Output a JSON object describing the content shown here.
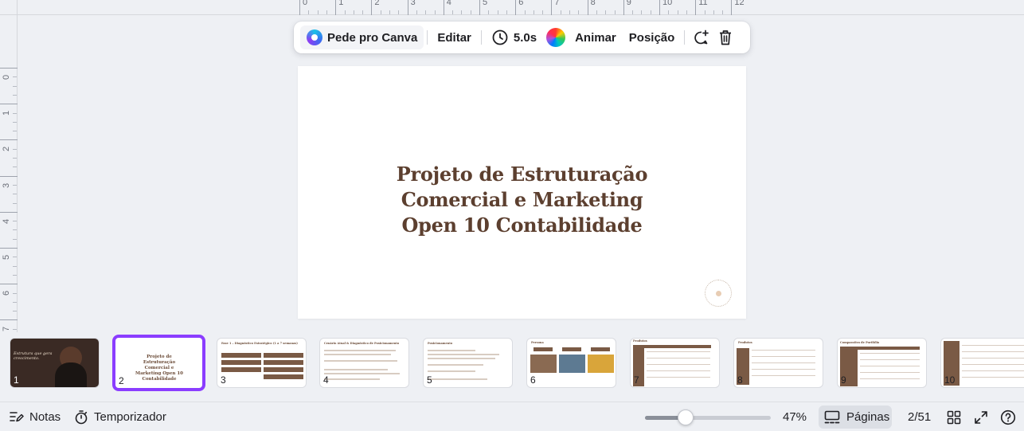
{
  "ruler": {
    "top_labels": [
      "0",
      "1",
      "2",
      "3",
      "4",
      "5",
      "6",
      "7",
      "8",
      "9",
      "10",
      "11",
      "12"
    ],
    "left_labels": [
      "0",
      "1",
      "2",
      "3",
      "4",
      "5",
      "6",
      "7"
    ]
  },
  "toolbar": {
    "ask_canva_label": "Pede pro Canva",
    "edit_label": "Editar",
    "duration_label": "5.0s",
    "animate_label": "Animar",
    "position_label": "Posição"
  },
  "slide": {
    "title_lines": [
      "Projeto de Estruturação",
      "Comercial e Marketing",
      "Open 10 Contabilidade"
    ]
  },
  "pages": [
    {
      "number": "1",
      "title": "Estrutura que gera crescimento."
    },
    {
      "number": "2",
      "title": "Projeto de Estruturação Comercial e Marketing Open 10 Contabilidade"
    },
    {
      "number": "3",
      "title": "Fase 1 – Diagnóstico Estratégico (1 a 7 semanas)"
    },
    {
      "number": "4",
      "title": "Cenário Atual & Diagnóstico de Posicionamento"
    },
    {
      "number": "5",
      "title": "Posicionamento"
    },
    {
      "number": "6",
      "title": "Persona"
    },
    {
      "number": "7",
      "title": "Produtos"
    },
    {
      "number": "8",
      "title": "Produtos"
    },
    {
      "number": "9",
      "title": "Comparativo de Portfólio"
    },
    {
      "number": "10",
      "title": ""
    }
  ],
  "bottombar": {
    "notes_label": "Notas",
    "timer_label": "Temporizador",
    "zoom_percent": 47,
    "zoom_label": "47%",
    "pages_label": "Páginas",
    "page_counter": "2/51"
  },
  "colors": {
    "accent": "#8b3dff",
    "title_brown": "#5c3f2f",
    "panel_bg": "#eef0f4"
  }
}
